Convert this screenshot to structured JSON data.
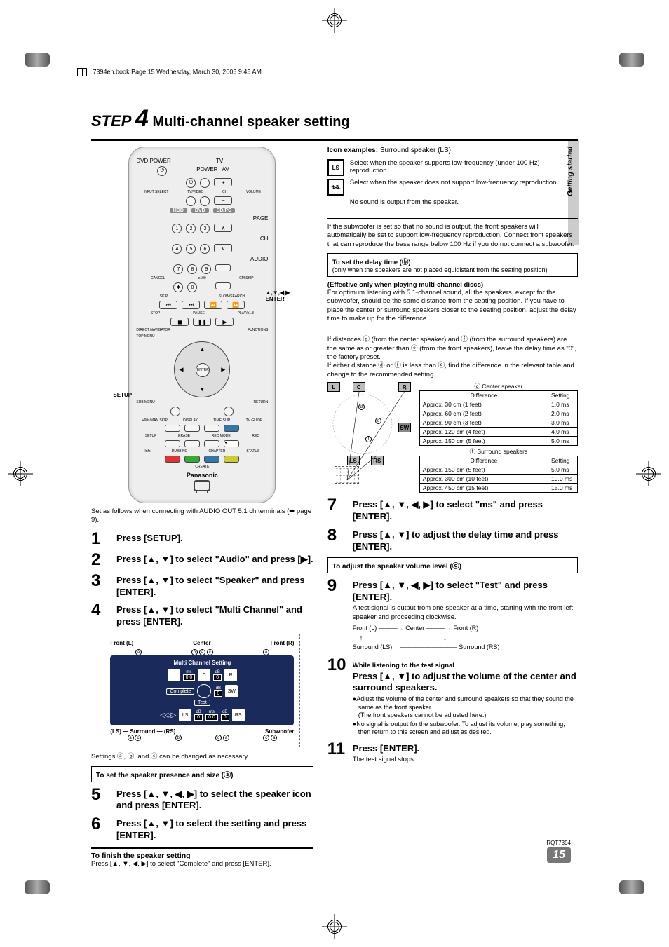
{
  "header": {
    "bookline": "7394en.book  Page 15  Wednesday, March 30, 2005  9:45 AM"
  },
  "title": {
    "step": "STEP",
    "num": "4",
    "text": "Multi-channel speaker setting"
  },
  "sideTab": "Getting started",
  "remote": {
    "dvdpower": "DVD POWER",
    "tv": "TV",
    "power": "POWER",
    "av": "AV",
    "plus": "+",
    "inputselect": "INPUT SELECT",
    "tvvideo": "TV/VIDEO",
    "ch": "CH",
    "volume": "VOLUME",
    "minus": "−",
    "hdd": "HDD",
    "dvd": "DVD",
    "sdpc": "SD/PC",
    "page": "PAGE",
    "num1": "1",
    "num2": "2",
    "num3": "3",
    "num4": "4",
    "num5": "5",
    "num6": "6",
    "num7": "7",
    "num8": "8",
    "num9": "9",
    "num0": "0",
    "cancel": "CANCEL",
    "x100": "x100",
    "audio": "AUDIO",
    "cmskip": "CM SKIP",
    "skip": "SKIP",
    "slow": "SLOW/SEARCH",
    "stop": "STOP",
    "pause": "PAUSE",
    "play": "PLAY/x1.3",
    "direct": "DIRECT NAVIGATOR",
    "functions": "FUNCTIONS",
    "topmenu": "TOP MENU",
    "enter": "ENTER",
    "submenu": "SUB MENU",
    "return": "RETURN",
    "display": "DISPLAY",
    "timeslip": "TIME SLIP",
    "tvguide": "TV GUIDE",
    "manskip": "+60s/MAN SKIP",
    "setup": "SETUP",
    "erase": "ERASE",
    "recmode": "REC MODE",
    "rec": "REC",
    "info": "Info",
    "dubbing": "DUBBING",
    "chapter": "CHAPTER",
    "status": "STATUS",
    "create": "CREATE",
    "brand": "Panasonic",
    "calloutArrows": "▲,▼,◀,▶",
    "calloutEnter": "ENTER",
    "calloutSetup": "SETUP"
  },
  "leftIntro": "Set as follows when connecting with AUDIO OUT 5.1 ch terminals (➡ page 9).",
  "steps": {
    "s1": "Press [SETUP].",
    "s2": "Press [▲, ▼] to select \"Audio\" and press [▶].",
    "s3": "Press [▲, ▼] to select \"Speaker\" and press [ENTER].",
    "s4": "Press [▲, ▼] to select \"Multi Channel\" and press [ENTER].",
    "s5": "Press [▲, ▼, ◀, ▶] to select the speaker icon and press [ENTER].",
    "s6": "Press [▲, ▼] to select the setting and press [ENTER].",
    "s7": "Press [▲, ▼, ◀, ▶] to select \"ms\" and press [ENTER].",
    "s8": "Press [▲, ▼] to adjust the delay time and press [ENTER].",
    "s9": "Press [▲, ▼, ◀, ▶] to select \"Test\" and press [ENTER].",
    "s9sub": "A test signal is output from one speaker at a time, starting with the front left speaker and proceeding clockwise.",
    "s9flow1": "Front (L) ———→ Center ———→ Front (R)",
    "s9flow2": "    ↑                                              ↓",
    "s9flow3": "Surround (LS) ←————————— Surround (RS)",
    "s10pre": "While listening to the test signal",
    "s10": "Press [▲, ▼] to adjust the volume of the center and surround speakers.",
    "s10b1": "●Adjust the volume of the center and surround speakers so that they sound the same as the front speaker.\n(The front speakers cannot be adjusted here.)",
    "s10b2": "●No signal is output for the subwoofer. To adjust its volume, play something, then return to this screen and adjust as desired.",
    "s11": "Press [ENTER].",
    "s11sub": "The test signal stops."
  },
  "mcs": {
    "title": "Multi Channel Setting",
    "frontL": "Front (L)",
    "center": "Center",
    "frontR": "Front (R)",
    "L": "L",
    "C": "C",
    "R": "R",
    "SW": "SW",
    "LS": "LS",
    "RS": "RS",
    "ms": "ms",
    "db": "dB",
    "v00": "0.0",
    "v0": "0",
    "complete": "Complete",
    "test": "Test",
    "surround": "Surround",
    "subwoofer": "Subwoofer",
    "ls": "(LS)",
    "rs": "(RS)"
  },
  "settingsNote": "Settings ⓐ, ⓑ, and ⓒ can be changed as necessary.",
  "boxPresence": "To set the speaker presence and size (ⓐ)",
  "finish": {
    "h": "To finish the speaker setting",
    "p": "Press [▲, ▼, ◀, ▶] to select \"Complete\" and press [ENTER]."
  },
  "iconEx": {
    "h": "Icon examples:",
    "hsub": " Surround speaker (LS)",
    "r1": "Select when the speaker supports low-frequency (under 100 Hz) reproduction.",
    "r2": "Select when the speaker does not support low-frequency reproduction.",
    "r3": "No sound is output from the speaker."
  },
  "subwooferNote": "If the subwoofer is set so that no sound is output, the front speakers will automatically be set to support low-frequency reproduction. Connect front speakers that can reproduce the bass range below 100 Hz if you do not connect a subwoofer.",
  "delayBox": {
    "h": "To set the delay time (ⓑ)",
    "p": "(only when the speakers are not placed equidistant from the seating position)"
  },
  "effective": {
    "h": "(Effective only when playing multi-channel discs)",
    "p": "For optimum listening with 5.1-channel sound, all the speakers, except for the subwoofer, should be the same distance from the seating position. If you have to place the center or surround speakers closer to the seating position, adjust the delay time to make up for the difference."
  },
  "distances": "If distances ⓓ (from the center speaker) and ⓕ (from the surround speakers) are the same as or greater than ⓔ (from the front speakers), leave the delay time as \"0\", the factory preset.\nIf either distance ⓓ or ⓕ is less than ⓔ, find the difference in the relevant table and change to the recommended setting.",
  "tableCenter": {
    "caption": "ⓓ Center speaker",
    "hDiff": "Difference",
    "hSet": "Setting",
    "rows": [
      [
        "Approx. 30 cm (1 feet)",
        "1.0 ms"
      ],
      [
        "Approx. 60 cm (2 feet)",
        "2.0 ms"
      ],
      [
        "Approx. 90 cm (3 feet)",
        "3.0 ms"
      ],
      [
        "Approx. 120 cm (4 feet)",
        "4.0 ms"
      ],
      [
        "Approx. 150 cm (5 feet)",
        "5.0 ms"
      ]
    ]
  },
  "tableSurround": {
    "caption": "ⓕ Surround speakers",
    "hDiff": "Difference",
    "hSet": "Setting",
    "rows": [
      [
        "Approx. 150 cm (5 feet)",
        "5.0 ms"
      ],
      [
        "Approx. 300 cm (10 feet)",
        "10.0 ms"
      ],
      [
        "Approx. 450 cm (15 feet)",
        "15.0 ms"
      ]
    ]
  },
  "roomLabels": {
    "L": "L",
    "C": "C",
    "R": "R",
    "SW": "SW",
    "LS": "LS",
    "RS": "RS",
    "d": "ⓓ",
    "e": "ⓔ",
    "f": "ⓕ"
  },
  "adjustVol": "To adjust the speaker volume level (ⓒ)",
  "footer": {
    "code": "RQT7394",
    "page": "15"
  }
}
